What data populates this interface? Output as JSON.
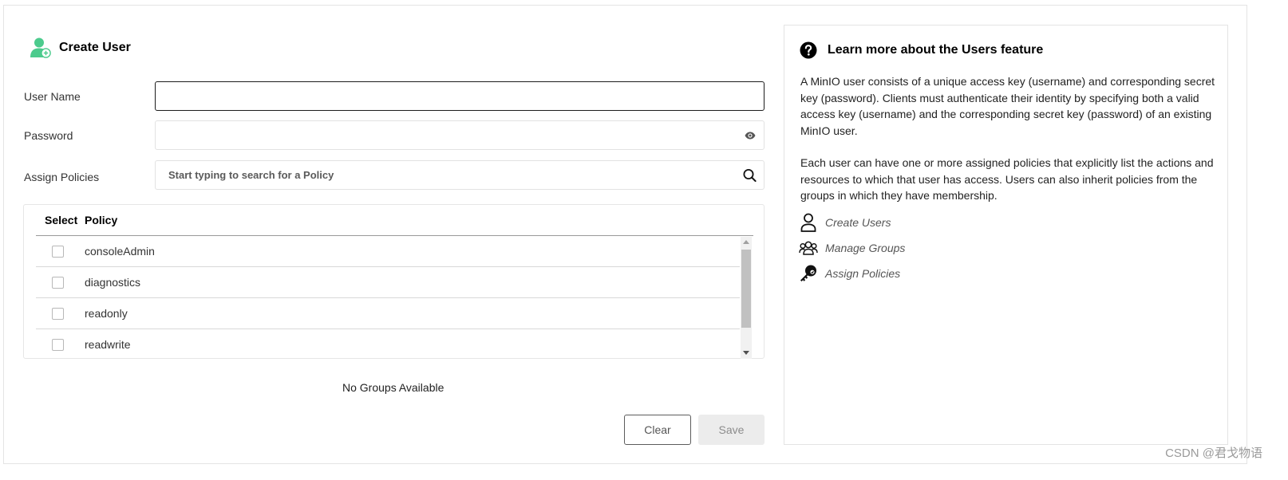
{
  "form": {
    "title": "Create User",
    "username": {
      "label": "User Name",
      "value": "",
      "placeholder": ""
    },
    "password": {
      "label": "Password",
      "value": "",
      "placeholder": ""
    },
    "policies": {
      "label": "Assign Policies",
      "search_placeholder": "Start typing to search for a Policy",
      "columns": {
        "select": "Select",
        "policy": "Policy"
      },
      "items": [
        {
          "name": "consoleAdmin",
          "checked": false
        },
        {
          "name": "diagnostics",
          "checked": false
        },
        {
          "name": "readonly",
          "checked": false
        },
        {
          "name": "readwrite",
          "checked": false
        }
      ]
    },
    "groups_message": "No Groups Available",
    "buttons": {
      "clear": "Clear",
      "save": "Save"
    }
  },
  "help": {
    "title": "Learn more about the Users feature",
    "paragraphs": [
      "A MinIO user consists of a unique access key (username) and corresponding secret key (password). Clients must authenticate their identity by specifying both a valid access key (username) and the corresponding secret key (password) of an existing MinIO user.",
      "Each user can have one or more assigned policies that explicitly list the actions and resources to which that user has access. Users can also inherit policies from the groups in which they have membership."
    ],
    "links": [
      {
        "label": "Create Users",
        "icon": "user-outline-icon"
      },
      {
        "label": "Manage Groups",
        "icon": "groups-icon"
      },
      {
        "label": "Assign Policies",
        "icon": "key-icon"
      }
    ]
  },
  "watermark": "CSDN @君戈物语",
  "colors": {
    "accent_green": "#4ccb8d",
    "border": "#e4e4e4",
    "save_disabled_bg": "#ececec"
  }
}
